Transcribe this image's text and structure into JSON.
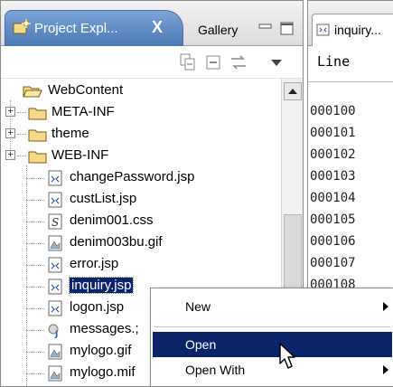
{
  "left_view": {
    "tabs": [
      {
        "label": "Project Expl...",
        "icon": "project-explorer-icon",
        "active": true
      },
      {
        "label": "Gallery",
        "active": false
      }
    ],
    "close_glyph": "X"
  },
  "tree": {
    "items": [
      {
        "label": "WebContent",
        "icon": "folder-open-icon",
        "depth": 0,
        "expander": null
      },
      {
        "label": "META-INF",
        "icon": "folder-icon",
        "depth": 1,
        "expander": "+"
      },
      {
        "label": "theme",
        "icon": "folder-icon",
        "depth": 1,
        "expander": "+"
      },
      {
        "label": "WEB-INF",
        "icon": "folder-icon",
        "depth": 1,
        "expander": "+"
      },
      {
        "label": "changePassword.jsp",
        "icon": "jsp-file-icon",
        "depth": 2
      },
      {
        "label": "custList.jsp",
        "icon": "jsp-file-icon",
        "depth": 2
      },
      {
        "label": "denim001.css",
        "icon": "css-file-icon",
        "depth": 2
      },
      {
        "label": "denim003bu.gif",
        "icon": "image-file-icon",
        "depth": 2
      },
      {
        "label": "error.jsp",
        "icon": "jsp-file-icon",
        "depth": 2
      },
      {
        "label": "inquiry.jsp",
        "icon": "jsp-file-icon",
        "depth": 2,
        "selected": true
      },
      {
        "label": "logon.jsp",
        "icon": "jsp-file-icon",
        "depth": 2
      },
      {
        "label": "messages.;",
        "icon": "properties-file-icon",
        "depth": 2
      },
      {
        "label": "mylogo.gif",
        "icon": "image-file-icon",
        "depth": 2
      },
      {
        "label": "mylogo.mif",
        "icon": "image-file-icon",
        "depth": 2
      }
    ]
  },
  "editor": {
    "tab_label": "inquiry...",
    "column_header": "Line",
    "line_numbers": [
      "000100",
      "000101",
      "000102",
      "000103",
      "000104",
      "000105",
      "000106",
      "000107",
      "000108"
    ]
  },
  "context_menu": {
    "items": [
      {
        "label": "New",
        "submenu": true,
        "highlighted": false
      },
      {
        "label": "Open",
        "submenu": false,
        "highlighted": true
      },
      {
        "label": "Open With",
        "submenu": true,
        "highlighted": false
      }
    ]
  },
  "colors": {
    "active_tab": "#4b78b5",
    "selection": "#0a246a",
    "folder": "#f4d98a"
  }
}
